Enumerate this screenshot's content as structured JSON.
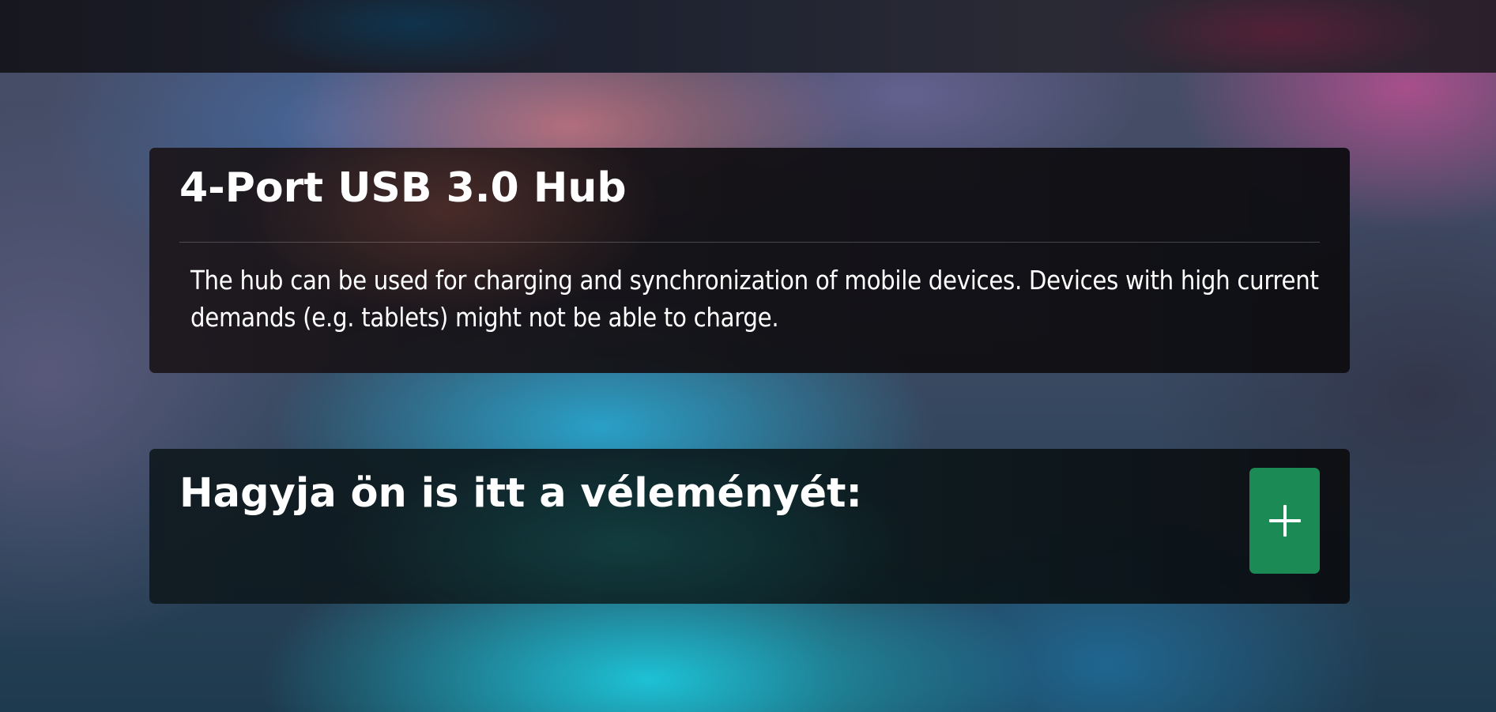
{
  "product": {
    "title": "4-Port USB 3.0 Hub",
    "description": "The hub can be used for charging and synchronization of mobile devices. Devices with high current demands (e.g. tablets) might not be able to charge."
  },
  "review": {
    "prompt": "Hagyja ön is itt a véleményét:",
    "add_button_icon": "plus-icon"
  },
  "colors": {
    "add_button": "#1b8a55",
    "card_background": "#121115",
    "text": "#ffffff"
  }
}
